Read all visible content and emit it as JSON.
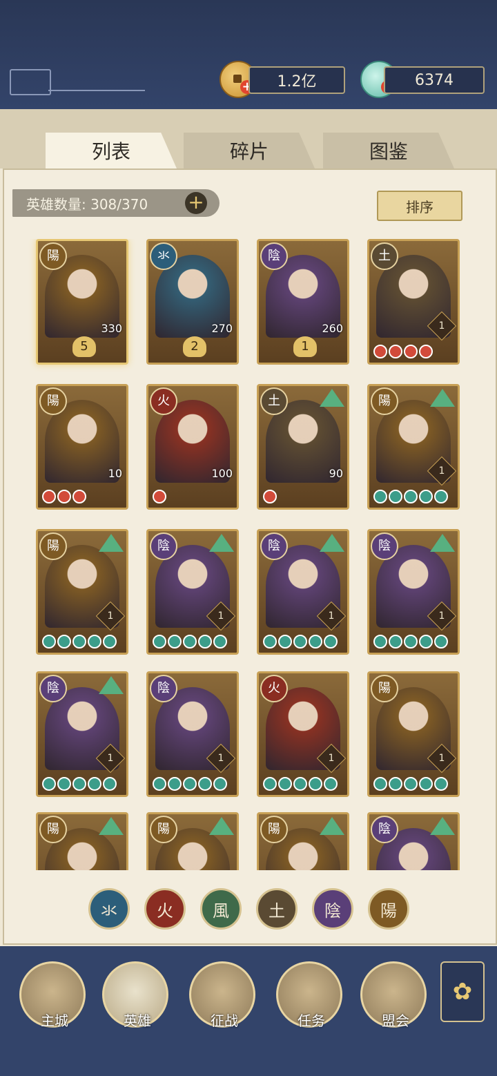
{
  "resources": {
    "coins": "1.2亿",
    "gems": "6374"
  },
  "tabs": [
    {
      "label": "列表"
    },
    {
      "label": "碎片"
    },
    {
      "label": "图鉴"
    }
  ],
  "hero_count": "英雄数量: 308/370",
  "sort_label": "排序",
  "element_glyphs": {
    "water": "氺",
    "fire": "火",
    "wind": "風",
    "earth": "土",
    "yin": "陰",
    "yang": "陽"
  },
  "heroes": [
    {
      "element": "陽",
      "num": "330",
      "star": "5",
      "selected": true
    },
    {
      "element": "氺",
      "num": "270",
      "star": "2"
    },
    {
      "element": "陰",
      "num": "260",
      "star": "1"
    },
    {
      "element": "土",
      "level": "1",
      "pips": 4,
      "pip_color": "red"
    },
    {
      "element": "陽",
      "num": "10",
      "pips": 3,
      "pip_color": "red"
    },
    {
      "element": "火",
      "num": "100",
      "pips": 1,
      "pip_color": "red"
    },
    {
      "element": "土",
      "num": "90",
      "pips": 1,
      "pip_color": "red",
      "up": true
    },
    {
      "element": "陽",
      "level": "1",
      "pips": 5,
      "pip_color": "teal",
      "up": true
    },
    {
      "element": "陽",
      "level": "1",
      "pips": 5,
      "pip_color": "teal",
      "up": true
    },
    {
      "element": "陰",
      "level": "1",
      "pips": 5,
      "pip_color": "teal",
      "up": true
    },
    {
      "element": "陰",
      "level": "1",
      "pips": 5,
      "pip_color": "teal",
      "up": true
    },
    {
      "element": "陰",
      "level": "1",
      "pips": 5,
      "pip_color": "teal",
      "up": true
    },
    {
      "element": "陰",
      "level": "1",
      "pips": 5,
      "pip_color": "teal",
      "up": true
    },
    {
      "element": "陰",
      "level": "1",
      "pips": 5,
      "pip_color": "teal"
    },
    {
      "element": "火",
      "level": "1",
      "pips": 5,
      "pip_color": "teal"
    },
    {
      "element": "陽",
      "level": "1",
      "pips": 5,
      "pip_color": "teal"
    },
    {
      "element": "陽",
      "up": true
    },
    {
      "element": "陽",
      "up": true
    },
    {
      "element": "陽",
      "up": true
    },
    {
      "element": "陰",
      "up": true
    }
  ],
  "filters": [
    "氺",
    "火",
    "風",
    "土",
    "陰",
    "陽"
  ],
  "nav": [
    {
      "label": "主城"
    },
    {
      "label": "英雄",
      "active": true
    },
    {
      "label": "征战"
    },
    {
      "label": "任务"
    },
    {
      "label": "盟会"
    }
  ],
  "colors": {
    "yin": "#5a3f78",
    "yang": "#7e5a24",
    "fire": "#8a2d22",
    "water": "#2c5e7a",
    "wind": "#3f6a4a",
    "earth": "#5a4a33"
  }
}
